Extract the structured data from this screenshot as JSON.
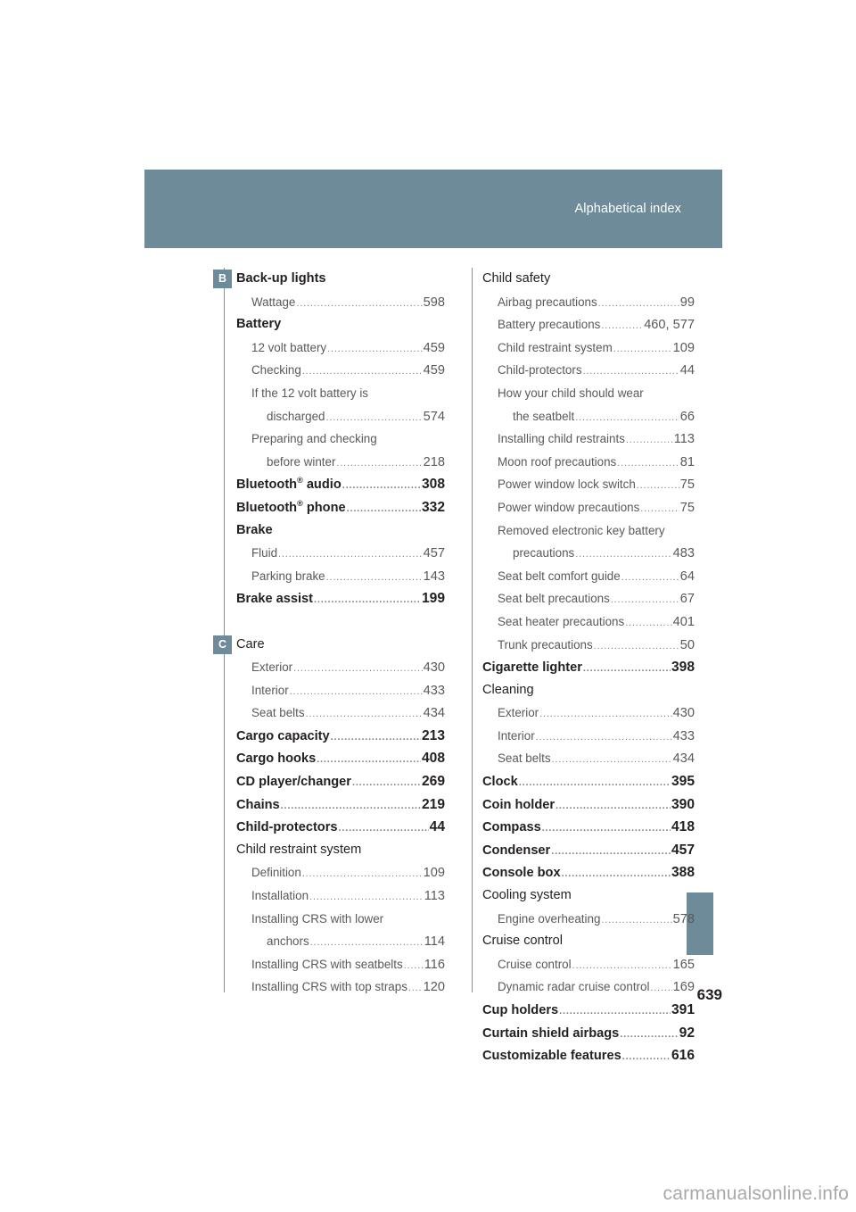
{
  "header": {
    "title": "Alphabetical index",
    "band_color": "#6d8b99"
  },
  "page_number": "639",
  "watermark": "carmanualsonline.info",
  "letter_markers": {
    "b": "B",
    "c": "C"
  },
  "columns": {
    "left": [
      {
        "level": 0,
        "label": "Back-up lights",
        "page": ""
      },
      {
        "level": 1,
        "label": "Wattage",
        "page": "598"
      },
      {
        "level": 0,
        "label": "Battery",
        "page": ""
      },
      {
        "level": 1,
        "label": "12 volt battery",
        "page": "459"
      },
      {
        "level": 1,
        "label": "Checking",
        "page": "459"
      },
      {
        "level": 1,
        "label": "If the 12 volt battery is",
        "page": ""
      },
      {
        "level": 2,
        "label": "discharged",
        "page": "574"
      },
      {
        "level": 1,
        "label": "Preparing and checking",
        "page": ""
      },
      {
        "level": 2,
        "label": "before winter",
        "page": "218"
      },
      {
        "level": 0,
        "label": "Bluetooth® audio",
        "page": "308",
        "sup": true
      },
      {
        "level": 0,
        "label": "Bluetooth® phone",
        "page": "332",
        "sup": true
      },
      {
        "level": 0,
        "label": "Brake",
        "page": ""
      },
      {
        "level": 1,
        "label": "Fluid",
        "page": "457"
      },
      {
        "level": 1,
        "label": "Parking brake",
        "page": "143"
      },
      {
        "level": 0,
        "label": "Brake assist",
        "page": "199"
      },
      {
        "level": -1,
        "label": "",
        "page": ""
      },
      {
        "level": 0,
        "label": "Care",
        "page": "",
        "plain": true
      },
      {
        "level": 1,
        "label": "Exterior",
        "page": "430"
      },
      {
        "level": 1,
        "label": "Interior",
        "page": "433"
      },
      {
        "level": 1,
        "label": "Seat belts",
        "page": "434"
      },
      {
        "level": 0,
        "label": "Cargo capacity",
        "page": "213"
      },
      {
        "level": 0,
        "label": "Cargo hooks",
        "page": "408"
      },
      {
        "level": 0,
        "label": "CD player/changer",
        "page": "269"
      },
      {
        "level": 0,
        "label": "Chains",
        "page": "219"
      },
      {
        "level": 0,
        "label": "Child-protectors",
        "page": "44"
      },
      {
        "level": 0,
        "label": "Child restraint system",
        "page": "",
        "plain": true
      },
      {
        "level": 1,
        "label": "Definition",
        "page": "109"
      },
      {
        "level": 1,
        "label": "Installation",
        "page": "113"
      },
      {
        "level": 1,
        "label": "Installing CRS with lower",
        "page": ""
      },
      {
        "level": 2,
        "label": "anchors",
        "page": "114"
      },
      {
        "level": 1,
        "label": "Installing CRS with seatbelts",
        "page": "116"
      },
      {
        "level": 1,
        "label": "Installing CRS with top straps",
        "page": "120"
      }
    ],
    "right": [
      {
        "level": 0,
        "label": "Child safety",
        "page": "",
        "plain": true
      },
      {
        "level": 1,
        "label": "Airbag precautions",
        "page": "99"
      },
      {
        "level": 1,
        "label": "Battery precautions",
        "page": "460, 577"
      },
      {
        "level": 1,
        "label": "Child restraint system",
        "page": "109"
      },
      {
        "level": 1,
        "label": "Child-protectors",
        "page": "44"
      },
      {
        "level": 1,
        "label": "How your child should wear",
        "page": ""
      },
      {
        "level": 2,
        "label": "the seatbelt",
        "page": "66"
      },
      {
        "level": 1,
        "label": "Installing child restraints",
        "page": "113"
      },
      {
        "level": 1,
        "label": "Moon roof precautions",
        "page": "81"
      },
      {
        "level": 1,
        "label": "Power window lock switch",
        "page": "75"
      },
      {
        "level": 1,
        "label": "Power window precautions",
        "page": "75"
      },
      {
        "level": 1,
        "label": "Removed electronic key battery",
        "page": ""
      },
      {
        "level": 2,
        "label": "precautions",
        "page": "483"
      },
      {
        "level": 1,
        "label": "Seat belt comfort guide",
        "page": "64"
      },
      {
        "level": 1,
        "label": "Seat belt precautions",
        "page": "67"
      },
      {
        "level": 1,
        "label": "Seat heater precautions",
        "page": "401"
      },
      {
        "level": 1,
        "label": "Trunk precautions",
        "page": "50"
      },
      {
        "level": 0,
        "label": "Cigarette lighter",
        "page": "398"
      },
      {
        "level": 0,
        "label": "Cleaning",
        "page": "",
        "plain": true
      },
      {
        "level": 1,
        "label": "Exterior",
        "page": "430"
      },
      {
        "level": 1,
        "label": "Interior",
        "page": "433"
      },
      {
        "level": 1,
        "label": "Seat belts",
        "page": "434"
      },
      {
        "level": 0,
        "label": "Clock",
        "page": "395"
      },
      {
        "level": 0,
        "label": "Coin holder",
        "page": "390"
      },
      {
        "level": 0,
        "label": "Compass",
        "page": "418"
      },
      {
        "level": 0,
        "label": "Condenser",
        "page": "457"
      },
      {
        "level": 0,
        "label": "Console box",
        "page": "388"
      },
      {
        "level": 0,
        "label": "Cooling system",
        "page": "",
        "plain": true
      },
      {
        "level": 1,
        "label": "Engine overheating",
        "page": "578"
      },
      {
        "level": 0,
        "label": "Cruise control",
        "page": "",
        "plain": true
      },
      {
        "level": 1,
        "label": "Cruise control",
        "page": "165"
      },
      {
        "level": 1,
        "label": "Dynamic radar cruise control",
        "page": "169"
      },
      {
        "level": 0,
        "label": "Cup holders",
        "page": "391"
      },
      {
        "level": 0,
        "label": "Curtain shield airbags",
        "page": "92"
      },
      {
        "level": 0,
        "label": "Customizable features",
        "page": "616"
      }
    ]
  }
}
